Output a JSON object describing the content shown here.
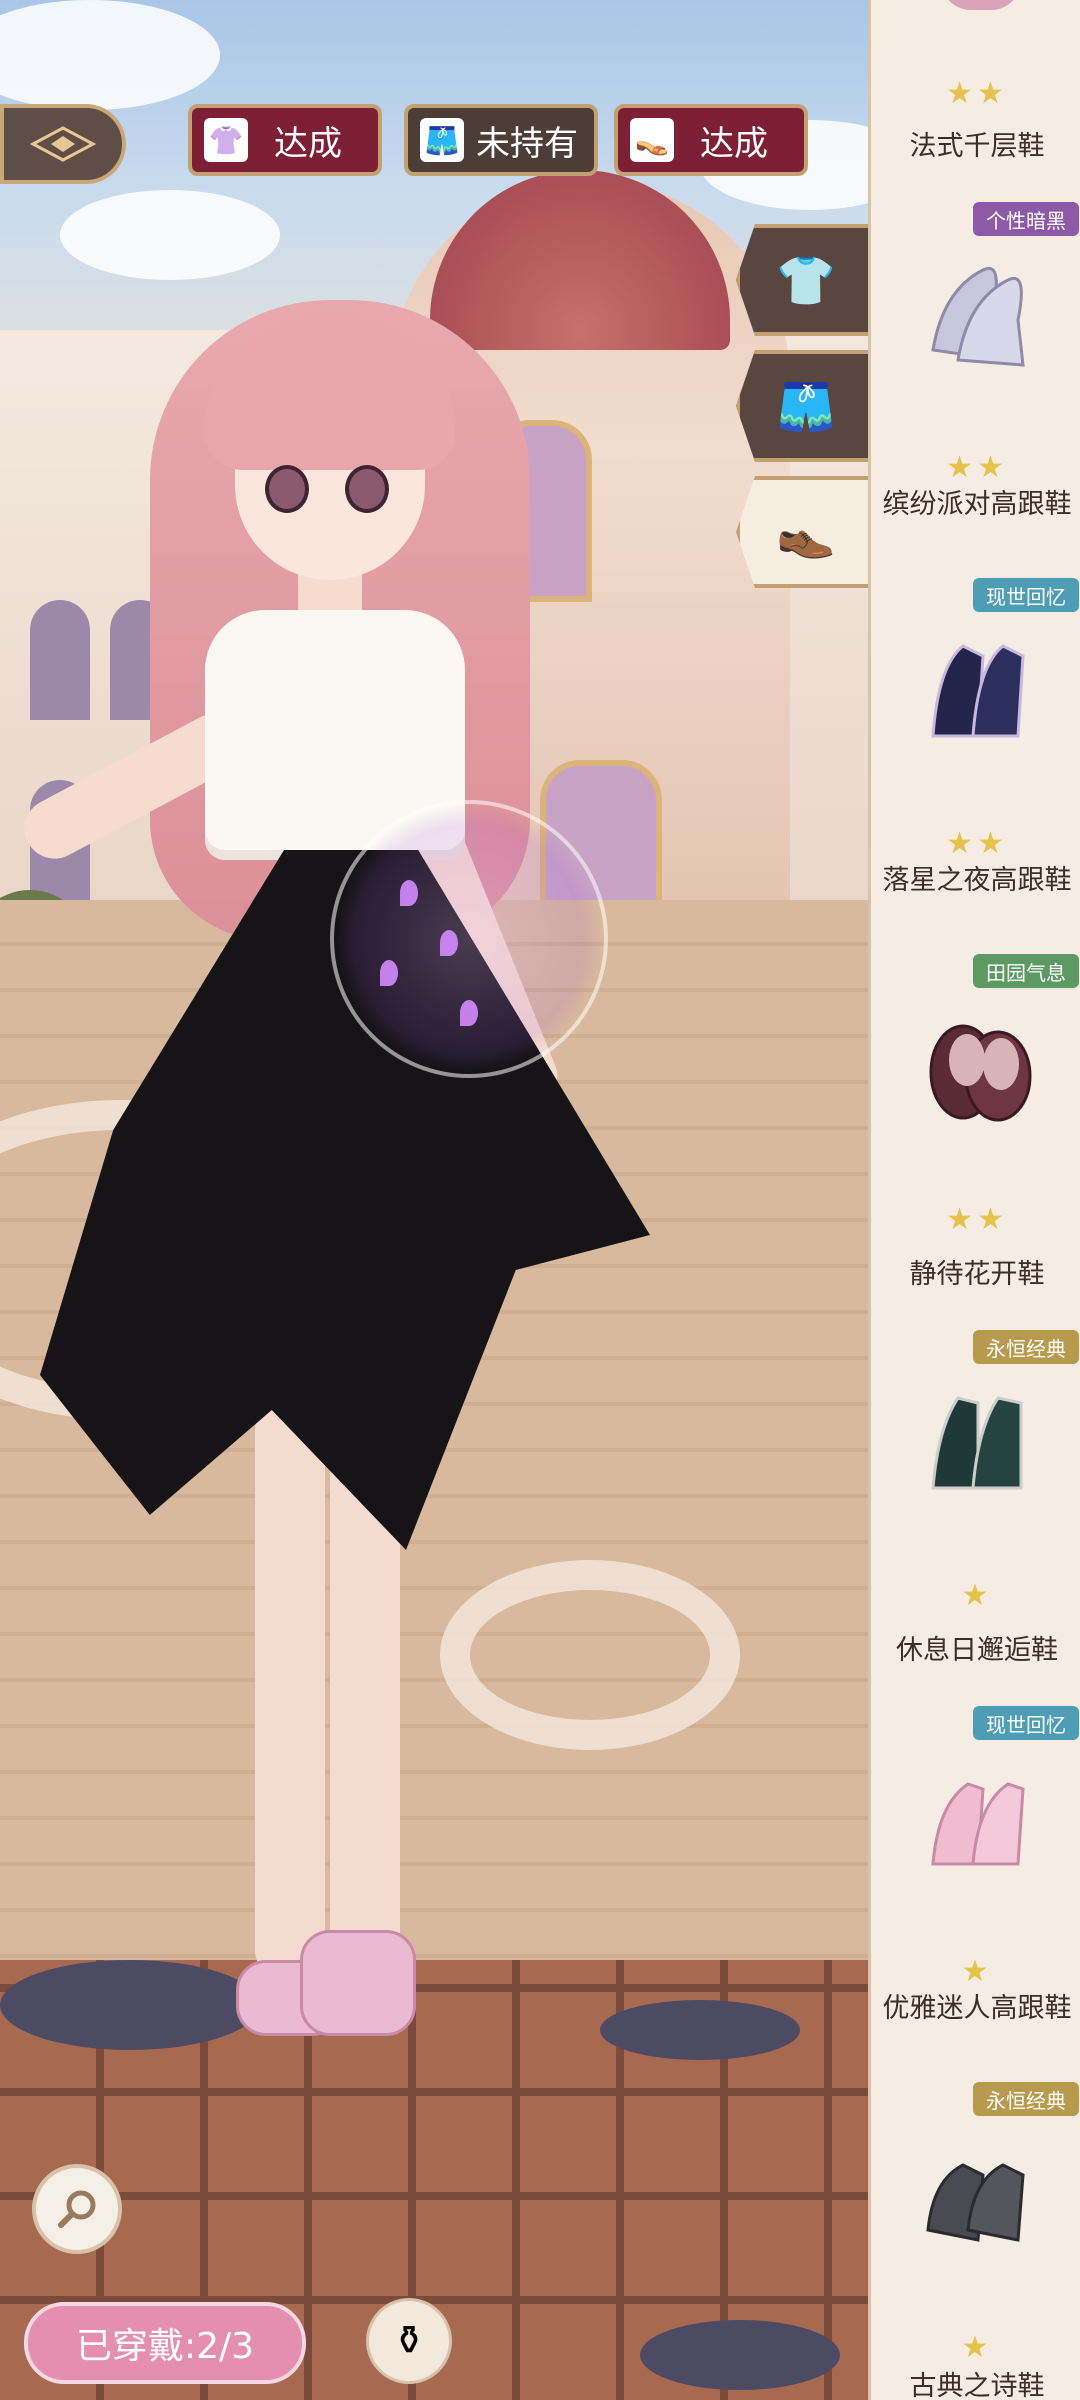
{
  "filters": [
    {
      "label": "达成",
      "icon": "blouse-icon",
      "style": "red"
    },
    {
      "label": "未持有",
      "icon": "pants-icon",
      "style": "dark"
    },
    {
      "label": "达成",
      "icon": "shoes-icon",
      "style": "red"
    }
  ],
  "category_tabs": [
    {
      "name": "top",
      "icon": "blouse-icon",
      "glyph": "👕",
      "active": false
    },
    {
      "name": "bottom",
      "icon": "shorts-icon",
      "glyph": "🩳",
      "active": false
    },
    {
      "name": "shoes",
      "icon": "shoes-icon",
      "glyph": "👞",
      "active": true
    }
  ],
  "status": {
    "worn_label": "已穿戴:2/3"
  },
  "items": [
    {
      "tag": "",
      "stars": "★★",
      "name": "法式千层鞋",
      "shoe_color": "#d9a2b8"
    },
    {
      "tag": "个性暗黑",
      "tag_color": "#8d5aa8",
      "stars": "★★",
      "name": "缤纷派对高跟鞋",
      "shoe_color": "#c8c6de"
    },
    {
      "tag": "现世回忆",
      "tag_color": "#4f9db5",
      "stars": "★★",
      "name": "落星之夜高跟鞋",
      "shoe_color": "#23254d"
    },
    {
      "tag": "田园气息",
      "tag_color": "#5d9a63",
      "stars": "★★",
      "name": "静待花开鞋",
      "shoe_color": "#5a2b35"
    },
    {
      "tag": "永恒经典",
      "tag_color": "#b89a4e",
      "stars": "★",
      "name": "休息日邂逅鞋",
      "shoe_color": "#1f3a36"
    },
    {
      "tag": "现世回忆",
      "tag_color": "#4f9db5",
      "stars": "★",
      "name": "优雅迷人高跟鞋",
      "shoe_color": "#efbcd0"
    },
    {
      "tag": "永恒经典",
      "tag_color": "#b89a4e",
      "stars": "★",
      "name": "古典之诗鞋",
      "shoe_color": "#4a4a52"
    }
  ]
}
